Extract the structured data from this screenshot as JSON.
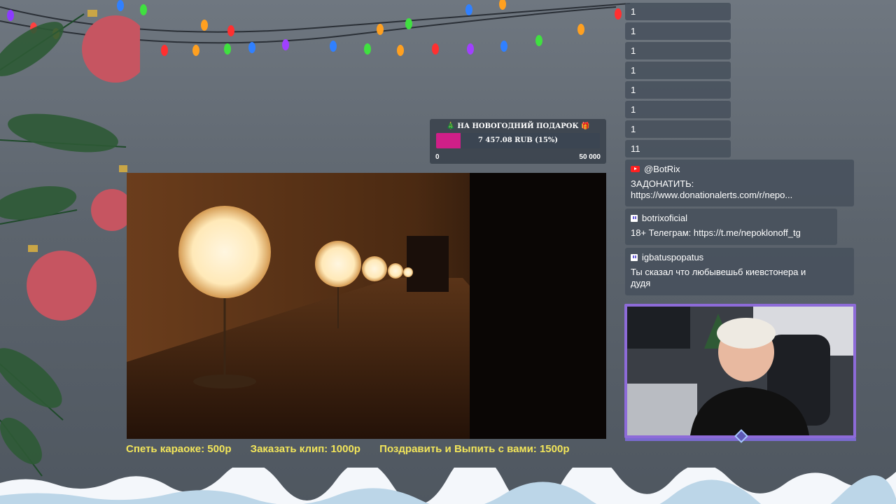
{
  "goal": {
    "title": "🎄 НА НОВОГОДНИЙ ПОДАРОК 🎁",
    "amount": "7 457.08 RUB (15%)",
    "progress": 0.15,
    "min": "0",
    "max": "50 000",
    "fill_color": "#d01f88"
  },
  "prices": {
    "karaoke": "Спеть караоке: 500р",
    "clip": "Заказать клип: 1000р",
    "congrats": "Поздравить и Выпить с вами: 1500р"
  },
  "chat": {
    "numbers": [
      "1",
      "1",
      "1",
      "1",
      "1",
      "1",
      "1",
      "11"
    ],
    "messages": [
      {
        "platform": "youtube",
        "platform_icon": "youtube-icon",
        "user": "@BotRix",
        "text": "ЗАДОНАТИТЬ: https://www.donationalerts.com/r/nepo..."
      },
      {
        "platform": "twitch",
        "platform_icon": "twitch-icon",
        "user": "botrixoficial",
        "text": "18+ Телеграм: https://t.me/nepoklonoff_tg"
      },
      {
        "platform": "twitch",
        "platform_icon": "twitch-icon",
        "user": "igbatuspopatus",
        "text": "Ты сказал что любывешьб киевстонера и дудя"
      }
    ]
  },
  "colors": {
    "price_text": "#f2e55a",
    "cam_border": "#8d6bd8",
    "youtube": "#ff2020"
  }
}
